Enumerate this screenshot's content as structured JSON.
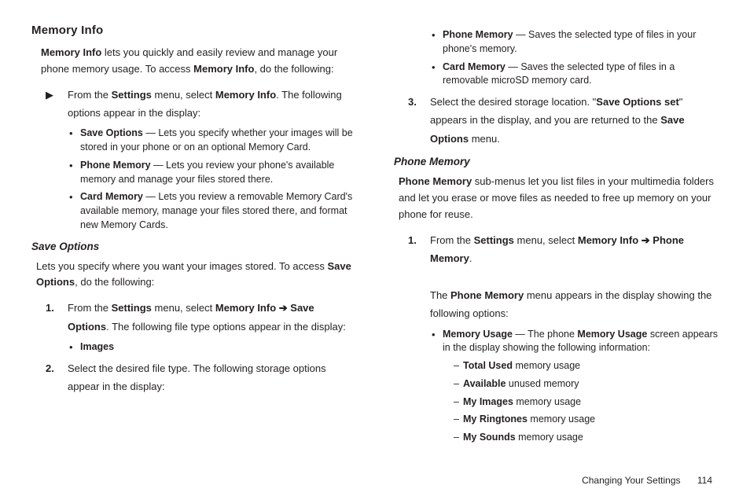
{
  "memoryInfo": {
    "title": "Memory Info",
    "intro_1a": "Memory Info",
    "intro_1b": " lets you quickly and easily review and manage your phone memory usage. To access ",
    "intro_1c": "Memory Info",
    "intro_1d": ", do the following:",
    "step_arrow_a": "From the ",
    "step_arrow_b": "Settings",
    "step_arrow_c": " menu, select ",
    "step_arrow_d": "Memory Info",
    "step_arrow_e": ". The following options appear in the display:",
    "opt1_lead": "Save Options",
    "opt1_body": " — Lets you specify whether your images will be stored in your phone or on an optional Memory Card.",
    "opt2_lead": "Phone Memory",
    "opt2_body": " — Lets you review your phone's available memory and manage your files stored there.",
    "opt3_lead": "Card Memory",
    "opt3_body": " — Lets you review a removable Memory Card's available memory, manage your files stored there, and format new Memory Cards."
  },
  "saveOptions": {
    "title": "Save Options",
    "intro_a": "Lets you specify where you want your images stored. To access ",
    "intro_b": "Save Options",
    "intro_c": ", do the following:",
    "s1_a": "From the ",
    "s1_b": "Settings",
    "s1_c": " menu, select ",
    "s1_d": "Memory Info",
    "s1_arrow": " ➔ ",
    "s1_e": "Save Options",
    "s1_f": ". The following file type options appear in the display:",
    "s1_bullet": "Images",
    "s2": "Select the desired file type. The following storage options appear in the display:",
    "s2_b1_lead": "Phone Memory",
    "s2_b1_body": " — Saves the selected type of files in your phone's memory.",
    "s2_b2_lead": "Card Memory",
    "s2_b2_body": " — Saves the selected type of files in a removable microSD memory card.",
    "s3_a": "Select the desired storage location. \"",
    "s3_b": "Save Options set",
    "s3_c": "\" appears in the display, and you are returned to the ",
    "s3_d": "Save Options",
    "s3_e": " menu."
  },
  "phoneMemory": {
    "title": "Phone Memory",
    "intro_a": "Phone Memory",
    "intro_b": " sub-menus let you list files in your multimedia folders and let you erase or move files as needed to free up memory on your phone for reuse.",
    "s1_a": "From the ",
    "s1_b": "Settings",
    "s1_c": " menu, select ",
    "s1_d": "Memory Info",
    "s1_arrow": " ➔ ",
    "s1_e": "Phone Memory",
    "s1_f": ".",
    "s1_g": "The ",
    "s1_h": "Phone Memory",
    "s1_i": " menu appears in the display showing the following options:",
    "b1_lead": "Memory Usage",
    "b1_mid": " — The phone ",
    "b1_lead2": "Memory Usage",
    "b1_body": " screen appears in the display showing the following information:",
    "d1_b": "Total Used",
    "d1_t": " memory usage",
    "d2_b": "Available",
    "d2_t": " unused memory",
    "d3_b": "My Images",
    "d3_t": " memory usage",
    "d4_b": "My Ringtones",
    "d4_t": " memory usage",
    "d5_b": "My Sounds",
    "d5_t": " memory usage"
  },
  "footer": {
    "section": "Changing Your Settings",
    "page": "114"
  }
}
